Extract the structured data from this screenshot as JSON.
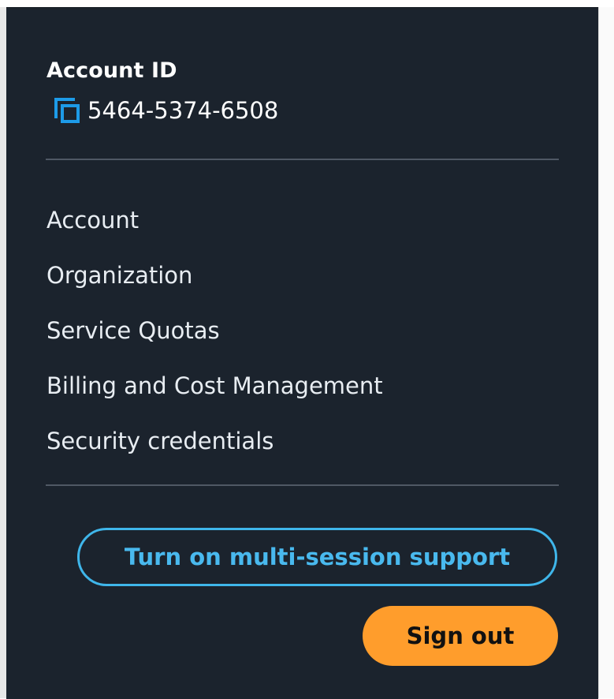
{
  "account": {
    "label": "Account ID",
    "id": "5464-5374-6508",
    "copy_icon": "copy-icon"
  },
  "menu": {
    "items": [
      {
        "label": "Account"
      },
      {
        "label": "Organization"
      },
      {
        "label": "Service Quotas"
      },
      {
        "label": "Billing and Cost Management"
      },
      {
        "label": "Security credentials"
      }
    ]
  },
  "actions": {
    "multi_session_label": "Turn on multi-session support",
    "sign_out_label": "Sign out"
  },
  "colors": {
    "panel_background": "#1b232d",
    "accent_blue": "#49b9ee",
    "sign_out_orange": "#ff9d2c",
    "divider": "#4f5864",
    "text": "#ffffff"
  }
}
